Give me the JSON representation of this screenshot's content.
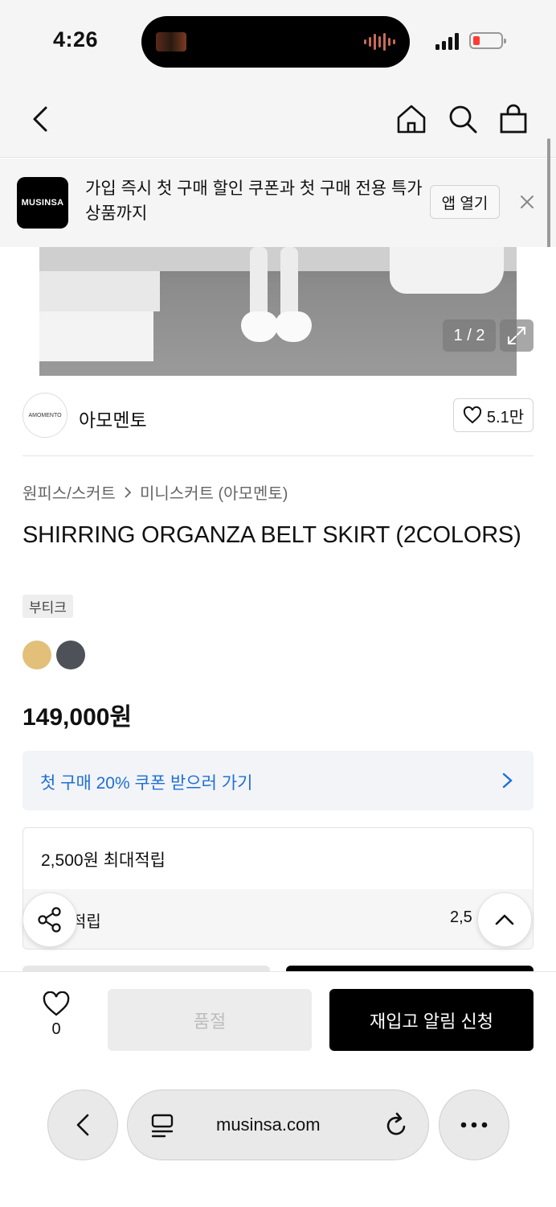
{
  "status_bar": {
    "time": "4:26"
  },
  "banner": {
    "logo_text": "MUSINSA",
    "message": "가입 즉시 첫 구매 할인 쿠폰과 첫 구매 전용 특가 상품까지",
    "open_app_label": "앱 열기"
  },
  "gallery": {
    "counter": "1 / 2"
  },
  "brand": {
    "logo_text": "AMOMENTO",
    "name": "아모멘토",
    "likes": "5.1만"
  },
  "product": {
    "category": "원피스/스커트",
    "subcategory": "미니스커트 (아모멘토)",
    "title": "SHIRRING ORGANZA BELT SKIRT (2COLORS)",
    "tag": "부티크",
    "swatches": [
      "#e2c07a",
      "#4e5157"
    ],
    "price": "149,000원"
  },
  "coupon": {
    "label": "첫 구매 20% 쿠폰 받으러 가기"
  },
  "points": {
    "headline": "2,500원 최대적립",
    "row_label": "적립",
    "row_value": "2,5"
  },
  "purchase_bar": {
    "wish_count": "0",
    "soldout_label": "품절",
    "restock_label": "재입고 알림 신청"
  },
  "browser": {
    "url": "musinsa.com"
  },
  "colors": {
    "accent_blue": "#1f6fd6",
    "black": "#000000"
  }
}
